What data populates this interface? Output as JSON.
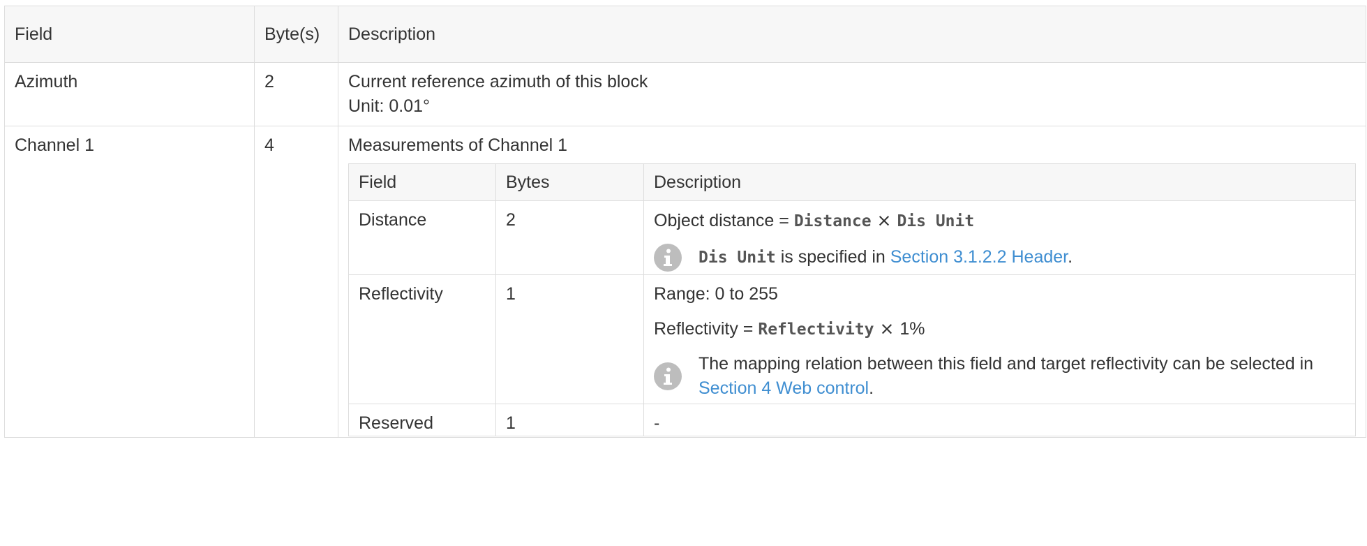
{
  "header": {
    "field": "Field",
    "bytes": "Byte(s)",
    "description": "Description"
  },
  "azimuth": {
    "field": "Azimuth",
    "bytes": "2",
    "desc_line1": "Current reference azimuth of this block",
    "desc_line2": "Unit: 0.01°"
  },
  "channel": {
    "field": "Channel 1",
    "bytes": "4",
    "desc_title": "Measurements of Channel 1",
    "inner_header": {
      "field": "Field",
      "bytes": "Bytes",
      "description": "Description"
    },
    "distance": {
      "field": "Distance",
      "bytes": "2",
      "formula_prefix": "Object distance = ",
      "formula_code1": "Distance",
      "formula_times": " × ",
      "formula_code2": "Dis Unit",
      "note_code": "Dis Unit",
      "note_text": " is specified in ",
      "note_link": "Section 3.1.2.2 Header",
      "note_end": "."
    },
    "reflectivity": {
      "field": "Reflectivity",
      "bytes": "1",
      "range": "Range: 0 to 255",
      "formula_prefix": "Reflectivity = ",
      "formula_code": "Reflectivity",
      "formula_times": " × ",
      "formula_suffix": "1%",
      "note_text": "The mapping relation between this field and target reflectivity can be selected in ",
      "note_link": "Section 4 Web control",
      "note_end": "."
    },
    "reserved": {
      "field": "Reserved",
      "bytes": "1",
      "description": "-"
    }
  },
  "icons": {
    "note_icon": "info-icon"
  },
  "colors": {
    "link": "#3f8ed1",
    "header_bg": "#f7f7f7",
    "border": "#dddddd",
    "icon_bg": "#bdbdbd"
  }
}
